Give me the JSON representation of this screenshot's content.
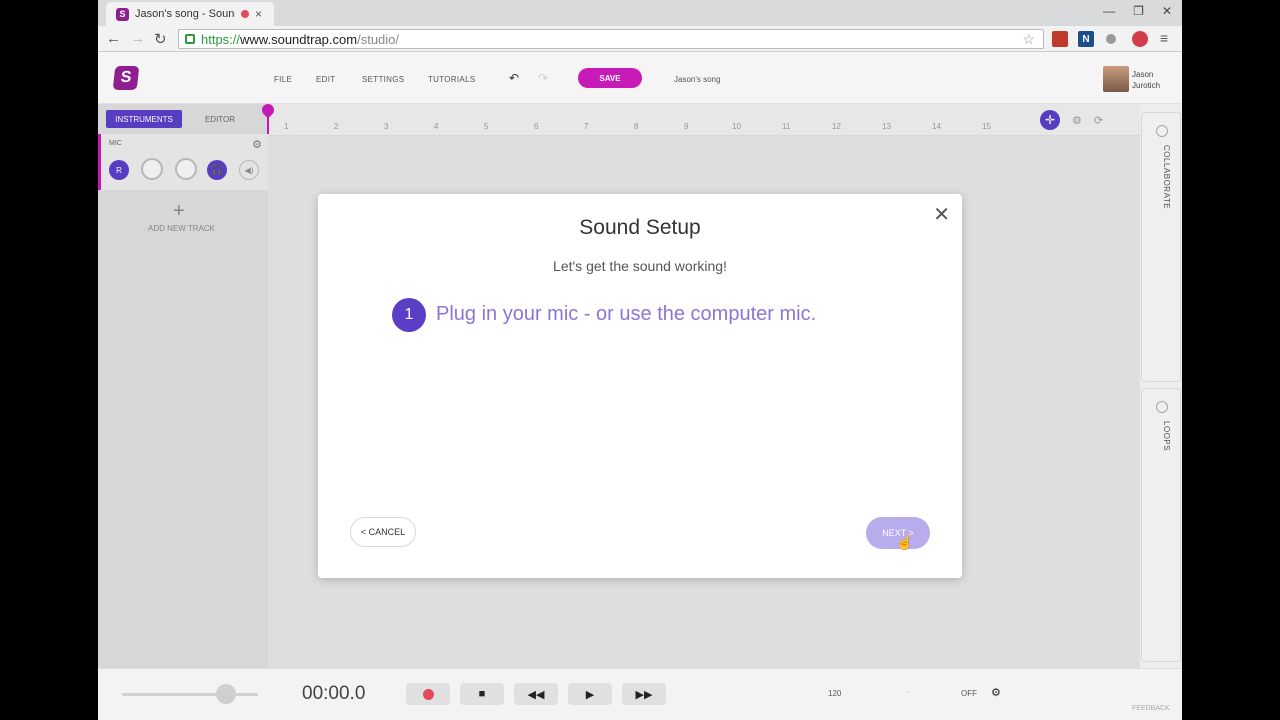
{
  "browser": {
    "tab_title": "Jason's song - Sound",
    "tab_close": "×",
    "url_scheme": "https://",
    "url_host": "www.soundtrap.com",
    "url_path": "/studio/",
    "window_controls": [
      "—",
      "❐",
      "✕"
    ]
  },
  "app": {
    "logo_letter": "S",
    "menu": [
      "FILE",
      "EDIT",
      "SETTINGS",
      "TUTORIALS"
    ],
    "save_label": "SAVE",
    "song_title": "Jason's song",
    "user": "Jason Jurotich"
  },
  "panel": {
    "tab_instruments": "INSTRUMENTS",
    "tab_editor": "EDITOR",
    "track_name": "MIC",
    "rec_arm": "R",
    "add_track": "ADD NEW TRACK"
  },
  "ruler": {
    "ticks": [
      "1",
      "2",
      "3",
      "4",
      "5",
      "6",
      "7",
      "8",
      "9",
      "10",
      "11",
      "12",
      "13",
      "14",
      "15"
    ]
  },
  "side": {
    "collaborate": "COLLABORATE",
    "loops": "LOOPS"
  },
  "transport": {
    "time": "00:00.0",
    "tempo": "120",
    "dash": "-",
    "metronome": "OFF",
    "feedback": "FEEDBACK"
  },
  "modal": {
    "title": "Sound Setup",
    "subtitle": "Let's get the sound working!",
    "step_number": "1",
    "step_text": "Plug in your mic - or use the computer mic.",
    "cancel_label": "< CANCEL",
    "next_label": "NEXT >"
  },
  "colors": {
    "brand_purple": "#5a3ec6",
    "save_magenta": "#c81ab8",
    "record_red": "#e24a5e"
  }
}
